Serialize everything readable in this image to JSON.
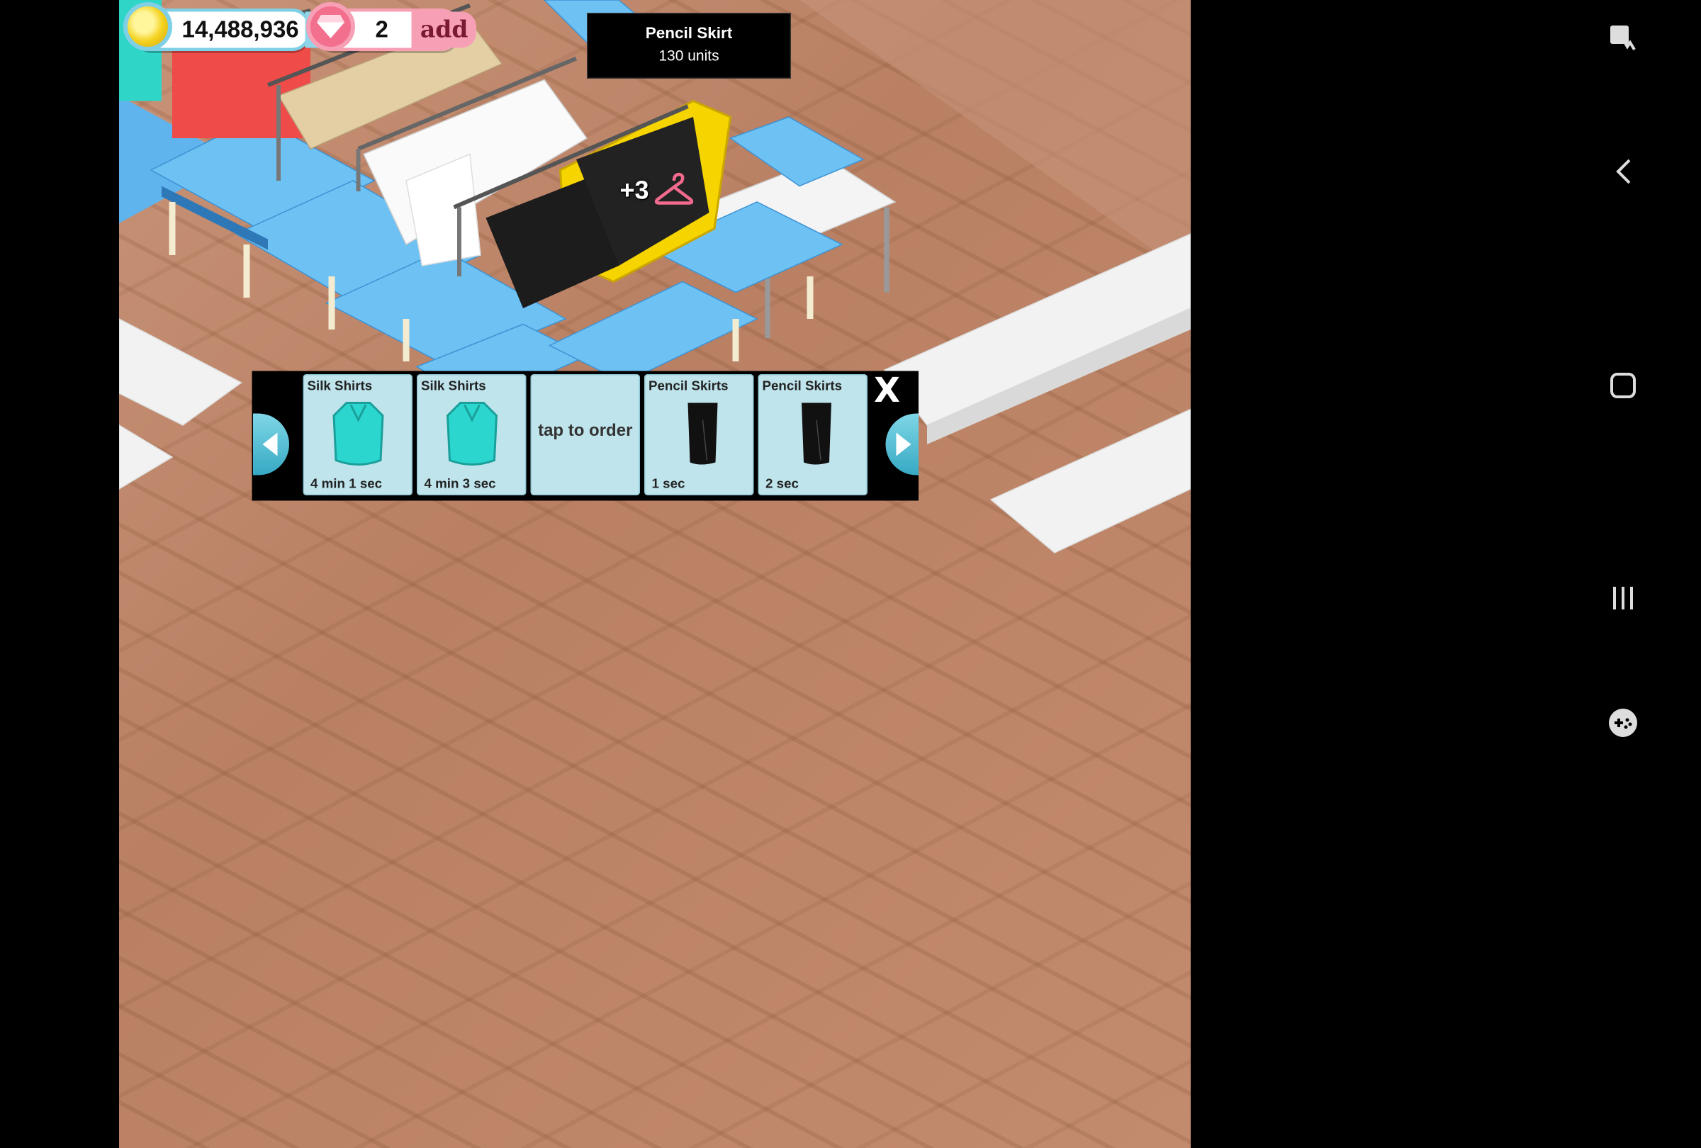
{
  "hud": {
    "coins": "14,488,936",
    "coins_add": "add",
    "gems": "2",
    "gems_add": "add"
  },
  "tooltip": {
    "title": "Pencil Skirt",
    "subtitle": "130 units"
  },
  "rack_bonus": "+3",
  "tray": {
    "close_label": "X",
    "slots": [
      {
        "title": "Silk Shirts",
        "time": "4 min 1 sec",
        "icon": "silk-shirt-icon"
      },
      {
        "title": "Silk Shirts",
        "time": "4 min 3 sec",
        "icon": "silk-shirt-icon"
      },
      {
        "center": "tap to order"
      },
      {
        "title": "Pencil Skirts",
        "time": "1 sec",
        "icon": "pencil-skirt-icon"
      },
      {
        "title": "Pencil Skirts",
        "time": "2 sec",
        "icon": "pencil-skirt-icon"
      }
    ]
  },
  "colors": {
    "floor": "#c08a6c",
    "counter_blue": "#5fb4ee",
    "tray_slot": "#bfe4ec",
    "highlight": "#f5d400"
  }
}
